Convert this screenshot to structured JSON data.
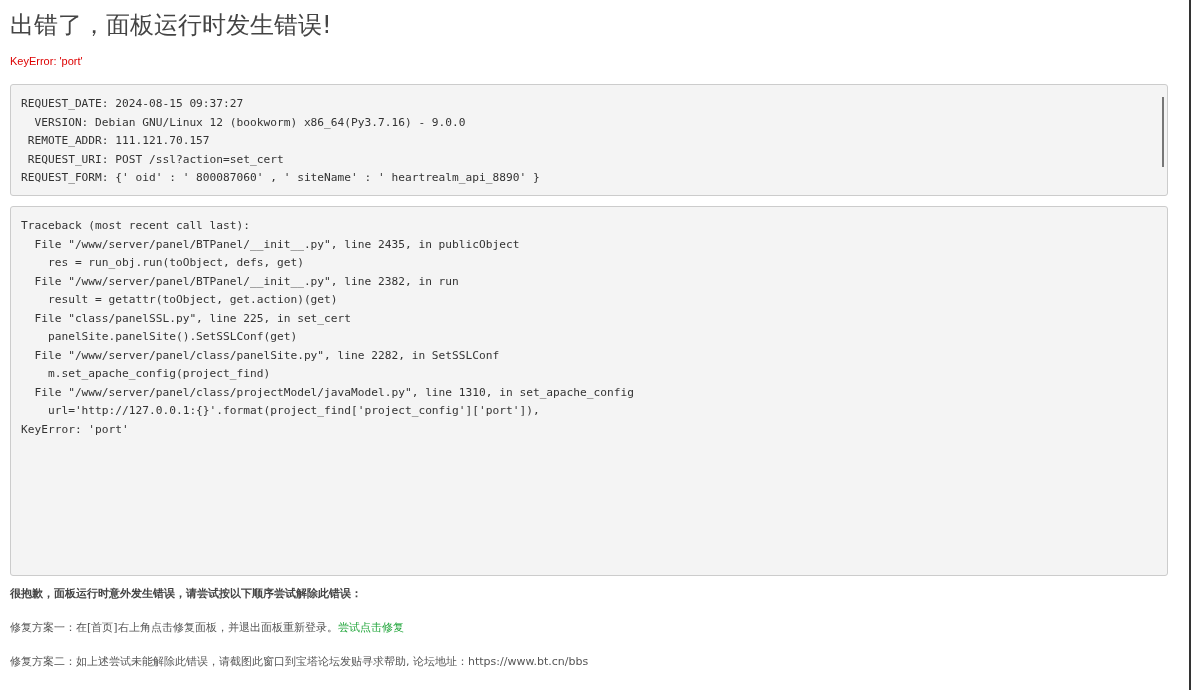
{
  "title": "出错了，面板运行时发生错误!",
  "error_message": "KeyError: 'port'",
  "request_info": {
    "lines": [
      "REQUEST_DATE: 2024-08-15 09:37:27",
      "  VERSION: Debian GNU/Linux 12 (bookworm) x86_64(Py3.7.16) - 9.0.0",
      " REMOTE_ADDR: 111.121.70.157",
      " REQUEST_URI: POST /ssl?action=set_cert",
      "REQUEST_FORM: {' oid' : ' 800087060' , ' siteName' : ' heartrealm_api_8890' }"
    ]
  },
  "traceback": {
    "lines": [
      "Traceback (most recent call last):",
      "  File \"/www/server/panel/BTPanel/__init__.py\", line 2435, in publicObject",
      "    res = run_obj.run(toObject, defs, get)",
      "  File \"/www/server/panel/BTPanel/__init__.py\", line 2382, in run",
      "    result = getattr(toObject, get.action)(get)",
      "  File \"class/panelSSL.py\", line 225, in set_cert",
      "    panelSite.panelSite().SetSSLConf(get)",
      "  File \"/www/server/panel/class/panelSite.py\", line 2282, in SetSSLConf",
      "    m.set_apache_config(project_find)",
      "  File \"/www/server/panel/class/projectModel/javaModel.py\", line 1310, in set_apache_config",
      "    url='http://127.0.0.1:{}'.format(project_find['project_config']['port']),",
      "KeyError: 'port'"
    ]
  },
  "apology": "很抱歉，面板运行时意外发生错误，请尝试按以下顺序尝试解除此错误：",
  "fix_one": {
    "text": "修复方案一：在[首页]右上角点击修复面板，并退出面板重新登录。",
    "link": "尝试点击修复"
  },
  "fix_two": "修复方案二：如上述尝试未能解除此错误，请截图此窗口到宝塔论坛发贴寻求帮助, 论坛地址：https://www.bt.cn/bbs"
}
